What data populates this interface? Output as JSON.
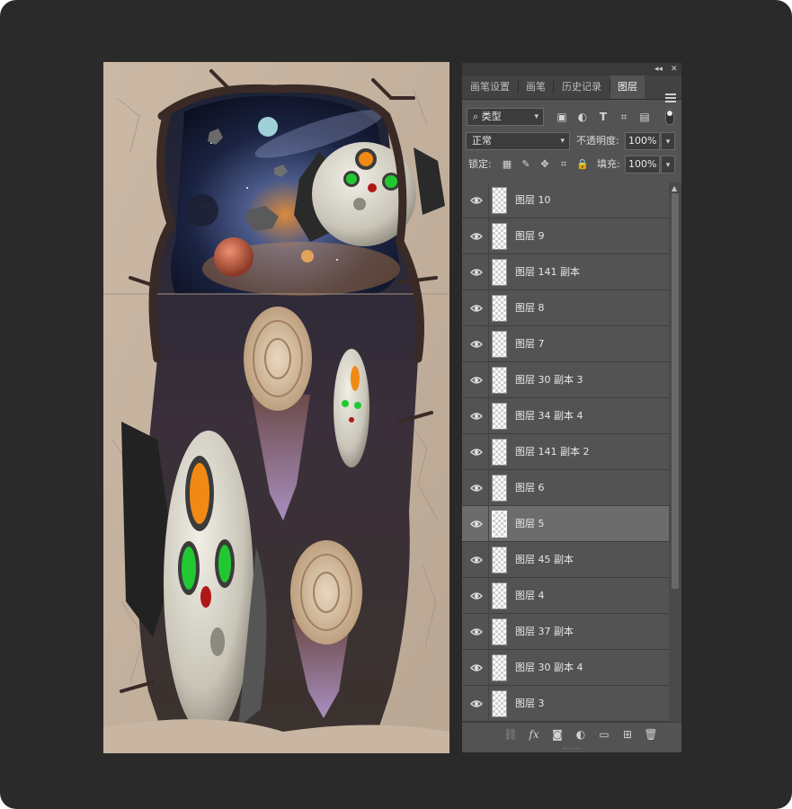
{
  "panel": {
    "collapse_icon": "double-chevron-left-icon",
    "close_icon": "close-icon",
    "tabs": [
      "画笔设置",
      "画笔",
      "历史记录",
      "图层"
    ],
    "active_tab": "图层",
    "menu_icon": "hamburger-menu-icon"
  },
  "filter": {
    "kind_label": "类型",
    "search_icon": "search-icon",
    "filter_icons": [
      "image-filter-icon",
      "adjustment-filter-icon",
      "type-filter-icon",
      "shape-filter-icon",
      "smart-object-filter-icon"
    ]
  },
  "blend": {
    "mode": "正常",
    "opacity_label": "不透明度:",
    "opacity_value": "100%"
  },
  "lock": {
    "label": "锁定:",
    "icons": [
      "lock-transparent-pixels-icon",
      "lock-image-pixels-icon",
      "lock-position-icon",
      "artboard-auto-nest-icon",
      "lock-all-icon"
    ],
    "fill_label": "填充:",
    "fill_value": "100%"
  },
  "layers": [
    {
      "name": "图层 10",
      "selected": false
    },
    {
      "name": "图层 9",
      "selected": false
    },
    {
      "name": "图层 141 副本",
      "selected": false
    },
    {
      "name": "图层 8",
      "selected": false
    },
    {
      "name": "图层 7",
      "selected": false
    },
    {
      "name": "图层 30 副本 3",
      "selected": false
    },
    {
      "name": "图层 34 副本 4",
      "selected": false
    },
    {
      "name": "图层 141 副本 2",
      "selected": false
    },
    {
      "name": "图层 6",
      "selected": false
    },
    {
      "name": "图层 5",
      "selected": true
    },
    {
      "name": "图层 45 副本",
      "selected": false
    },
    {
      "name": "图层 4",
      "selected": false
    },
    {
      "name": "图层 37 副本",
      "selected": false
    },
    {
      "name": "图层 30 副本 4",
      "selected": false
    },
    {
      "name": "图层 3",
      "selected": false
    }
  ],
  "bottom_icons": [
    "link-layers-icon",
    "fx-icon",
    "add-mask-icon",
    "adjustment-layer-icon",
    "new-group-icon",
    "new-layer-icon",
    "delete-icon"
  ],
  "colors": {
    "panel_bg": "#535353",
    "selected_row": "#6c6c6c",
    "app_bg": "#2a2a2a"
  }
}
